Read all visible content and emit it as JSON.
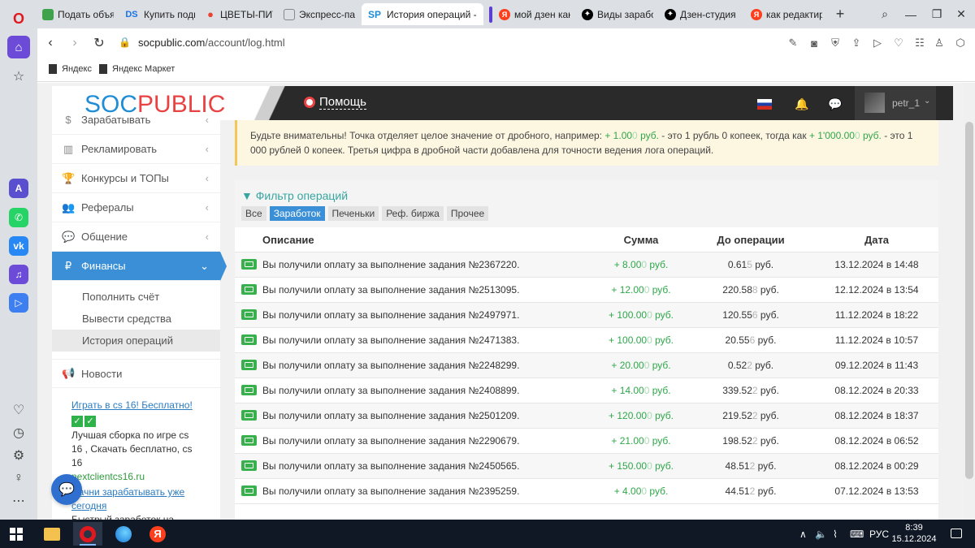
{
  "browser": {
    "tabs": [
      {
        "icon": "grid-icon",
        "title": "Подать объявл"
      },
      {
        "icon": "ds-icon",
        "title": "Купить подпис"
      },
      {
        "icon": "map-pin-icon",
        "title": "ЦВЕТЫ-ПИТЕР"
      },
      {
        "icon": "tiles-icon",
        "title": "Экспресс-пане"
      },
      {
        "icon": "sp-icon",
        "title": "История операций - соб",
        "active": true
      },
      {
        "icon": "yandex-icon",
        "title": "мой дзен канал"
      },
      {
        "icon": "dzen-icon",
        "title": "Виды заработк"
      },
      {
        "icon": "dzen-icon",
        "title": "Дзен-студия | Г"
      },
      {
        "icon": "yandex-icon",
        "title": "как редактиров"
      }
    ],
    "url_host": "socpublic.com",
    "url_path": "/account/log.html",
    "bookmarks": [
      "Яндекс",
      "Яндекс Маркет"
    ]
  },
  "site": {
    "logo_left": "SOC",
    "logo_right": "PUBLIC",
    "help": "Помощь",
    "username": "petr_1"
  },
  "menu": {
    "items": {
      "earn": "Зарабатывать",
      "advertise": "Рекламировать",
      "contests": "Конкурсы и ТОПы",
      "referrals": "Рефералы",
      "communication": "Общение",
      "finances": "Финансы",
      "news": "Новости"
    },
    "finance_sub": {
      "topup": "Пополнить счёт",
      "withdraw": "Вывести средства",
      "history": "История операций"
    },
    "ad1": {
      "link": "Играть в cs 16! Бесплатно!",
      "text": "Лучшая сборка по игре cs 16 , Скачать бесплатно, cs 16",
      "domain": "nextclientcs16.ru"
    },
    "ad2": {
      "link": "Начни зарабатывать уже сегодня",
      "text": "Быстрый заработок на"
    }
  },
  "warning": {
    "part1": "Будьте внимательны! Точка отделяет целое значение от дробного, например: ",
    "ex1_main": "+ 1.00",
    "ex1_fade": "0",
    "ex1_unit": " руб.",
    "part2": " - это 1 рубль 0 копеек, тогда как ",
    "ex2_main": "+ 1'000.00",
    "ex2_fade": "0",
    "ex2_unit": " руб.",
    "part3": " - это 1 000 рублей 0 копеек. Третья цифра в дробной части добавлена для точности ведения лога операций."
  },
  "filter": {
    "title": "Фильтр операций",
    "buttons": [
      "Все",
      "Заработок",
      "Печеньки",
      "Реф. биржа",
      "Прочее"
    ],
    "selected": "Заработок"
  },
  "table": {
    "headers": {
      "desc": "Описание",
      "sum": "Сумма",
      "balance": "До операции",
      "date": "Дата"
    },
    "unit": " руб.",
    "rows": [
      {
        "desc": "Вы получили оплату за выполнение задания №2367220.",
        "sum": "+ 8.00",
        "sum_f": "0",
        "bal": "0.61",
        "bal_f": "5",
        "date": "13.12.2024 в 14:48"
      },
      {
        "desc": "Вы получили оплату за выполнение задания №2513095.",
        "sum": "+ 12.00",
        "sum_f": "0",
        "bal": "220.58",
        "bal_f": "8",
        "date": "12.12.2024 в 13:54"
      },
      {
        "desc": "Вы получили оплату за выполнение задания №2497971.",
        "sum": "+ 100.00",
        "sum_f": "0",
        "bal": "120.55",
        "bal_f": "6",
        "date": "11.12.2024 в 18:22"
      },
      {
        "desc": "Вы получили оплату за выполнение задания №2471383.",
        "sum": "+ 100.00",
        "sum_f": "0",
        "bal": "20.55",
        "bal_f": "6",
        "date": "11.12.2024 в 10:57"
      },
      {
        "desc": "Вы получили оплату за выполнение задания №2248299.",
        "sum": "+ 20.00",
        "sum_f": "0",
        "bal": "0.52",
        "bal_f": "2",
        "date": "09.12.2024 в 11:43"
      },
      {
        "desc": "Вы получили оплату за выполнение задания №2408899.",
        "sum": "+ 14.00",
        "sum_f": "0",
        "bal": "339.52",
        "bal_f": "2",
        "date": "08.12.2024 в 20:33"
      },
      {
        "desc": "Вы получили оплату за выполнение задания №2501209.",
        "sum": "+ 120.00",
        "sum_f": "0",
        "bal": "219.52",
        "bal_f": "2",
        "date": "08.12.2024 в 18:37"
      },
      {
        "desc": "Вы получили оплату за выполнение задания №2290679.",
        "sum": "+ 21.00",
        "sum_f": "0",
        "bal": "198.52",
        "bal_f": "2",
        "date": "08.12.2024 в 06:52"
      },
      {
        "desc": "Вы получили оплату за выполнение задания №2450565.",
        "sum": "+ 150.00",
        "sum_f": "0",
        "bal": "48.51",
        "bal_f": "2",
        "date": "08.12.2024 в 00:29"
      },
      {
        "desc": "Вы получили оплату за выполнение задания №2395259.",
        "sum": "+ 4.00",
        "sum_f": "0",
        "bal": "44.51",
        "bal_f": "2",
        "date": "07.12.2024 в 13:53"
      }
    ]
  },
  "taskbar": {
    "lang": "РУС",
    "time": "8:39",
    "date": "15.12.2024"
  },
  "colors": {
    "accent": "#3a8fd6",
    "positive": "#2ea84a",
    "header_dark": "#2a2a2a",
    "opera_red": "#e1181e"
  }
}
